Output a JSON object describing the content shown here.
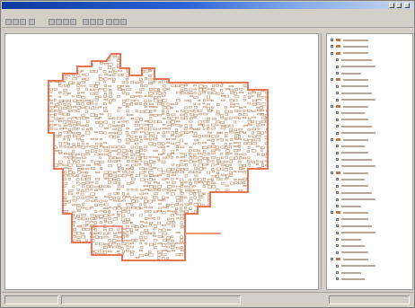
{
  "window": {
    "title": ""
  },
  "menu": {
    "items": [
      "",
      "",
      ""
    ]
  },
  "toolbar": {
    "tools": [
      "open-icon",
      "save-icon",
      "print-icon",
      "pan-icon",
      "zoom-in-icon",
      "zoom-out-icon",
      "identify-icon",
      "select-icon",
      "measure-icon",
      "layer-icon",
      "refresh-icon",
      "help-icon",
      "find-icon",
      "label-icon"
    ]
  },
  "map": {
    "boundary_color": "#e87456",
    "parcel_color": "#b37a4c"
  },
  "toc": {
    "items": [
      {
        "label": "",
        "has_swatch": true
      },
      {
        "label": "",
        "has_swatch": true
      },
      {
        "label": "",
        "has_swatch": true
      },
      {
        "label": "",
        "has_swatch": false
      },
      {
        "label": "",
        "has_swatch": false
      },
      {
        "label": "",
        "has_swatch": false
      },
      {
        "label": "",
        "has_swatch": true
      },
      {
        "label": "",
        "has_swatch": false
      },
      {
        "label": "",
        "has_swatch": false
      },
      {
        "label": "",
        "has_swatch": false
      },
      {
        "label": "",
        "has_swatch": true
      },
      {
        "label": "",
        "has_swatch": false
      },
      {
        "label": "",
        "has_swatch": false
      },
      {
        "label": "",
        "has_swatch": false
      },
      {
        "label": "",
        "has_swatch": false
      },
      {
        "label": "",
        "has_swatch": true
      },
      {
        "label": "",
        "has_swatch": false
      },
      {
        "label": "",
        "has_swatch": false
      },
      {
        "label": "",
        "has_swatch": false
      },
      {
        "label": "",
        "has_swatch": false
      },
      {
        "label": "",
        "has_swatch": true
      },
      {
        "label": "",
        "has_swatch": false
      },
      {
        "label": "",
        "has_swatch": false
      },
      {
        "label": "",
        "has_swatch": false
      },
      {
        "label": "",
        "has_swatch": false
      },
      {
        "label": "",
        "has_swatch": false
      },
      {
        "label": "",
        "has_swatch": true
      },
      {
        "label": "",
        "has_swatch": false
      },
      {
        "label": "",
        "has_swatch": false
      },
      {
        "label": "",
        "has_swatch": false
      },
      {
        "label": "",
        "has_swatch": false
      },
      {
        "label": "",
        "has_swatch": false
      },
      {
        "label": "",
        "has_swatch": false
      },
      {
        "label": "",
        "has_swatch": true
      },
      {
        "label": "",
        "has_swatch": false
      },
      {
        "label": "",
        "has_swatch": false
      },
      {
        "label": "",
        "has_swatch": false
      }
    ]
  },
  "status": {
    "left": "",
    "middle": "",
    "right": ""
  }
}
